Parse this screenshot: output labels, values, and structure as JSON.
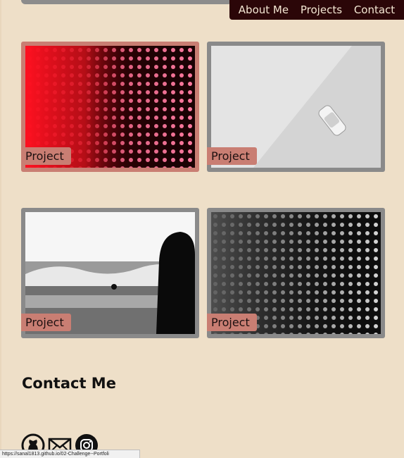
{
  "nav": {
    "items": [
      {
        "label": "About Me"
      },
      {
        "label": "Projects"
      },
      {
        "label": "Contact"
      }
    ]
  },
  "projects": [
    {
      "label": "Project",
      "image": "red-led-wall"
    },
    {
      "label": "Project",
      "image": "white-car-diagonal"
    },
    {
      "label": "Project",
      "image": "surfer-silhouette-beach"
    },
    {
      "label": "Project",
      "image": "grey-led-wall"
    }
  ],
  "contact": {
    "heading": "Contact Me",
    "icons": [
      "github-icon",
      "mail-icon",
      "instagram-icon"
    ]
  },
  "status_bar": {
    "url": "https://sanal1813.github.io/02-Challenge--Portfoli"
  },
  "colors": {
    "background": "#eedfc8",
    "navbar": "#2b0608",
    "accent": "#c97e73",
    "card_grey": "#8a8a8a"
  }
}
